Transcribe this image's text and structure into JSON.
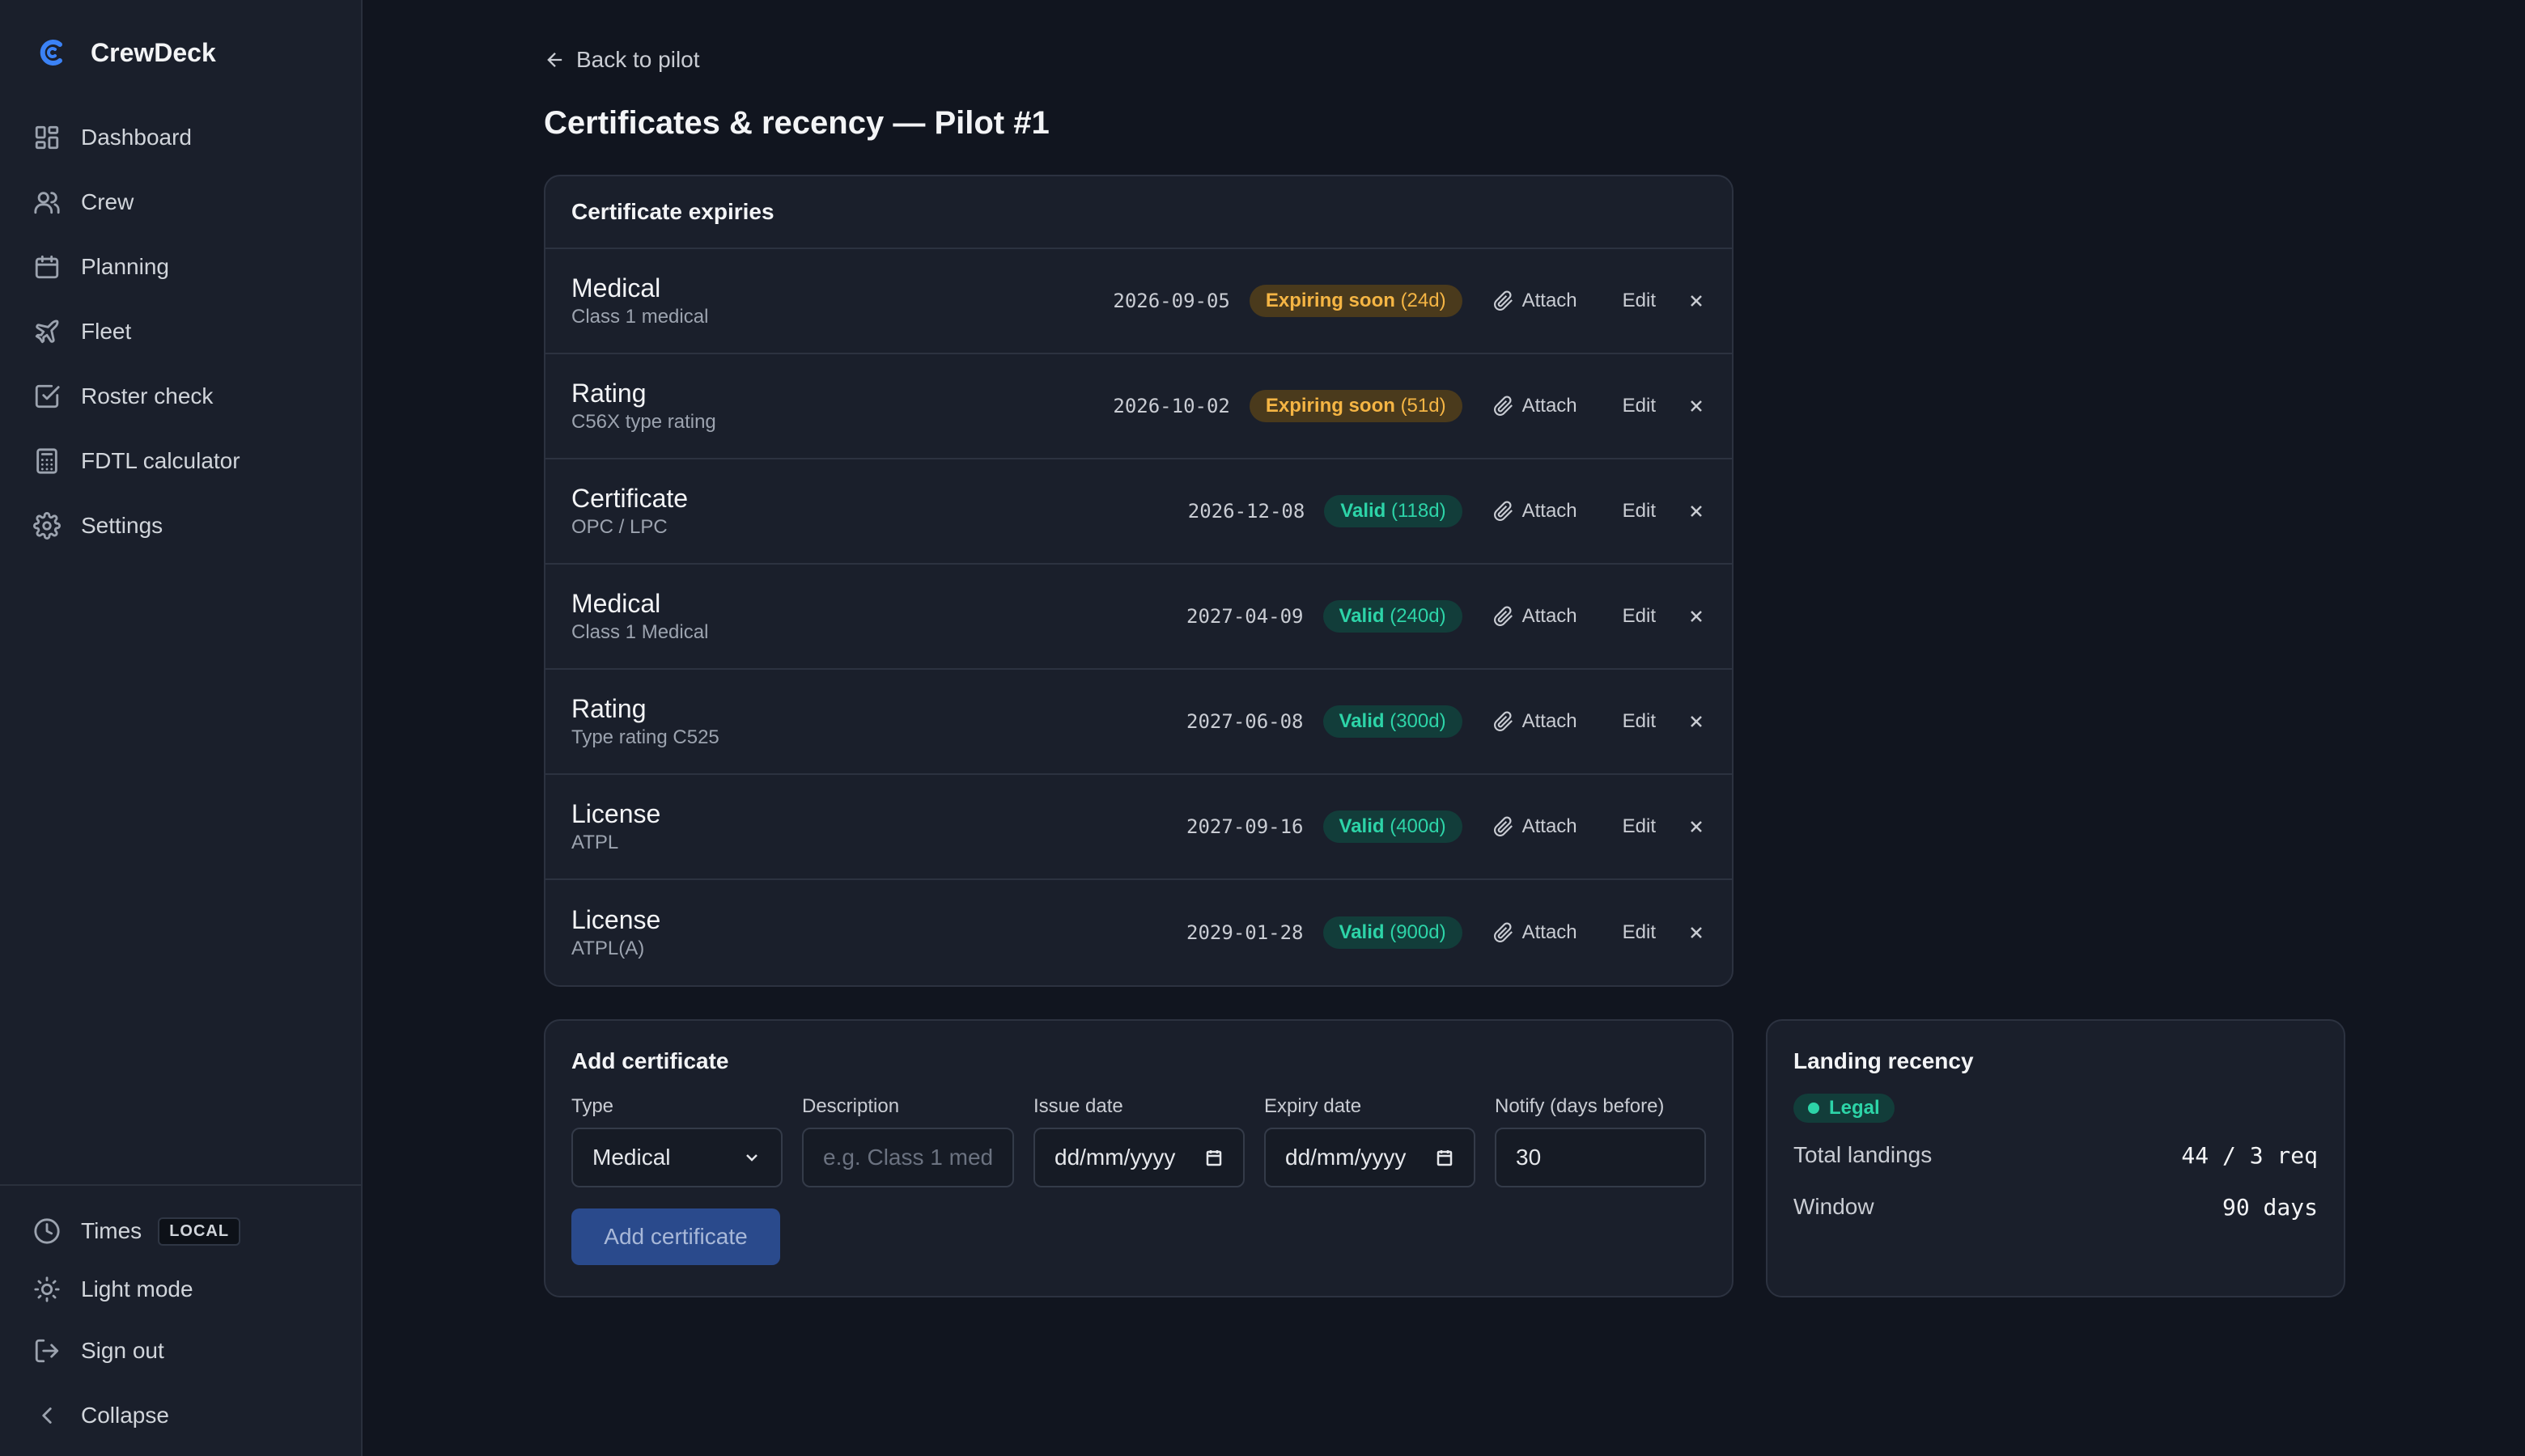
{
  "app": {
    "name": "CrewDeck"
  },
  "sidebar": {
    "items": [
      {
        "label": "Dashboard",
        "icon": "dashboard-icon"
      },
      {
        "label": "Crew",
        "icon": "users-icon"
      },
      {
        "label": "Planning",
        "icon": "calendar-icon"
      },
      {
        "label": "Fleet",
        "icon": "plane-icon"
      },
      {
        "label": "Roster check",
        "icon": "check-square-icon"
      },
      {
        "label": "FDTL calculator",
        "icon": "calculator-icon"
      },
      {
        "label": "Settings",
        "icon": "gear-icon"
      }
    ],
    "bottom": {
      "times_label": "Times",
      "times_badge": "LOCAL",
      "light_mode": "Light mode",
      "sign_out": "Sign out",
      "collapse": "Collapse"
    }
  },
  "header": {
    "back_label": "Back to pilot",
    "title": "Certificates & recency — Pilot #1"
  },
  "expiries": {
    "title": "Certificate expiries",
    "attach_label": "Attach",
    "edit_label": "Edit",
    "rows": [
      {
        "type": "Medical",
        "description": "Class 1 medical",
        "date": "2026-09-05",
        "status": "Expiring soon",
        "days": "(24d)",
        "status_kind": "warn"
      },
      {
        "type": "Rating",
        "description": "C56X type rating",
        "date": "2026-10-02",
        "status": "Expiring soon",
        "days": "(51d)",
        "status_kind": "warn"
      },
      {
        "type": "Certificate",
        "description": "OPC / LPC",
        "date": "2026-12-08",
        "status": "Valid",
        "days": "(118d)",
        "status_kind": "valid"
      },
      {
        "type": "Medical",
        "description": "Class 1 Medical",
        "date": "2027-04-09",
        "status": "Valid",
        "days": "(240d)",
        "status_kind": "valid"
      },
      {
        "type": "Rating",
        "description": "Type rating C525",
        "date": "2027-06-08",
        "status": "Valid",
        "days": "(300d)",
        "status_kind": "valid"
      },
      {
        "type": "License",
        "description": "ATPL",
        "date": "2027-09-16",
        "status": "Valid",
        "days": "(400d)",
        "status_kind": "valid"
      },
      {
        "type": "License",
        "description": "ATPL(A)",
        "date": "2029-01-28",
        "status": "Valid",
        "days": "(900d)",
        "status_kind": "valid"
      }
    ]
  },
  "add_certificate": {
    "title": "Add certificate",
    "type_label": "Type",
    "type_value": "Medical",
    "description_label": "Description",
    "description_placeholder": "e.g. Class 1 med",
    "issue_label": "Issue date",
    "issue_placeholder": "dd/mm/yyyy",
    "expiry_label": "Expiry date",
    "expiry_placeholder": "dd/mm/yyyy",
    "notify_label": "Notify (days before)",
    "notify_value": "30",
    "button_label": "Add certificate"
  },
  "recency": {
    "title": "Landing recency",
    "status": "Legal",
    "total_label": "Total landings",
    "total_value": "44 / 3 req",
    "window_label": "Window",
    "window_value": "90 days"
  },
  "colors": {
    "accent": "#3b82f6",
    "warn": "#f5b544",
    "valid": "#2dd4a8"
  }
}
